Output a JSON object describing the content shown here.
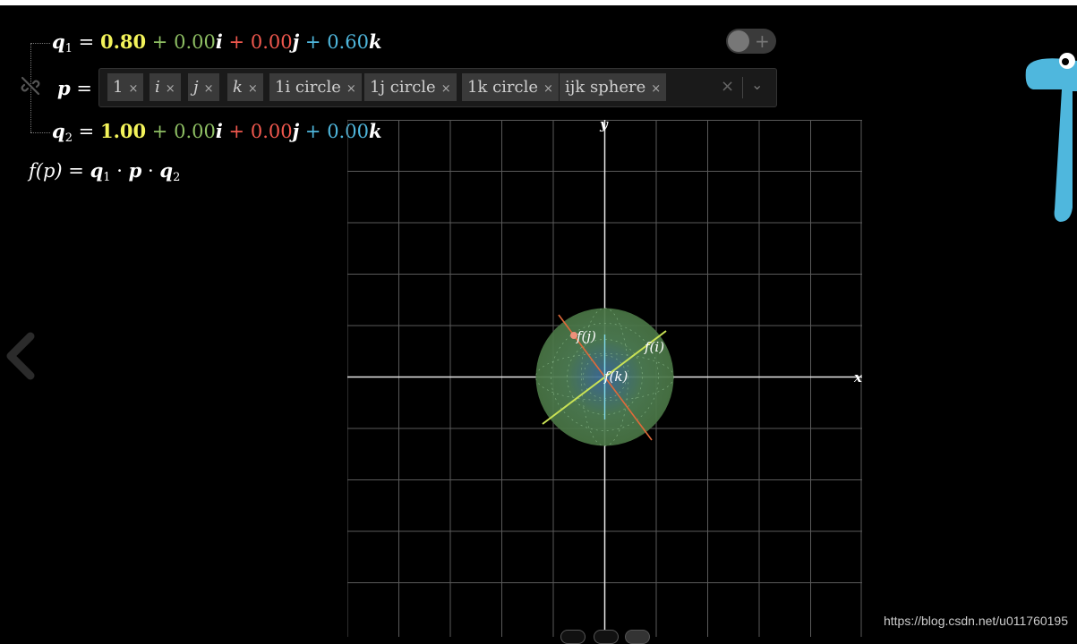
{
  "equations": {
    "q1": {
      "lhs": "q",
      "sub": "1",
      "eq": "=",
      "w": "0.80",
      "i": "0.00",
      "j": "0.00",
      "k": "0.60",
      "plus": "+",
      "i_sym": "i",
      "j_sym": "j",
      "k_sym": "k"
    },
    "p": {
      "lhs": "p",
      "eq": "="
    },
    "q2": {
      "lhs": "q",
      "sub": "2",
      "eq": "=",
      "w": "1.00",
      "i": "0.00",
      "j": "0.00",
      "k": "0.00",
      "plus": "+",
      "i_sym": "i",
      "j_sym": "j",
      "k_sym": "k"
    },
    "f": {
      "text_lhs": "f(p)",
      "eq": "=",
      "q1": "q",
      "q1_sub": "1",
      "dot": "·",
      "p": "p",
      "q2": "q",
      "q2_sub": "2"
    }
  },
  "p_list": {
    "chips": [
      {
        "label": "1",
        "close": "×"
      },
      {
        "label": "i",
        "close": "×"
      },
      {
        "label": "j",
        "close": "×"
      },
      {
        "label": "k",
        "close": "×"
      },
      {
        "label": "1i circle",
        "close": "×"
      },
      {
        "label": "1j circle",
        "close": "×"
      },
      {
        "label": "1k circle",
        "close": "×"
      },
      {
        "label": "ijk sphere",
        "close": "×"
      }
    ],
    "clear_label": "×",
    "dropdown_icon": "chevron-down-icon"
  },
  "graph": {
    "x_label": "x",
    "y_label": "y",
    "labels": {
      "fj": "f(j)",
      "fi": "f(i)",
      "fk": "f(k)"
    }
  },
  "watermark": "https://blog.csdn.net/u011760195",
  "colors": {
    "yellow": "#f3f35a",
    "green": "#8ebf63",
    "red": "#f0584e",
    "blue": "#4fb7dd",
    "sphere": "#4f7a4a",
    "mascot": "#4fb7dd"
  },
  "icons": [
    "link-off-icon",
    "back-chevron-icon",
    "toggle-plus-icon",
    "mascot-icon"
  ]
}
